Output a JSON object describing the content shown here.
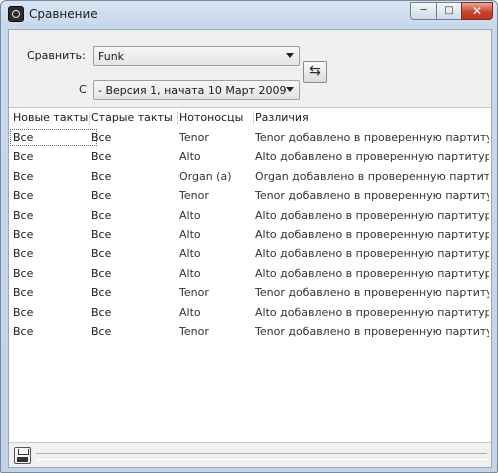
{
  "window": {
    "title": "Сравнение",
    "icon": "app-icon"
  },
  "compare": {
    "label": "Сравнить:",
    "value": "Funk",
    "with_label": "С",
    "with_value": "- Версия 1, начата 10 Март 2009",
    "swap_icon": "swap-arrows-icon"
  },
  "table": {
    "headers": [
      "Новые такты",
      "Старые такты",
      "Нотоносцы",
      "Различия"
    ],
    "rows": [
      [
        "Все",
        "Все",
        "Tenor",
        "Tenor добавлено в проверенную партиту..."
      ],
      [
        "Все",
        "Все",
        "Alto",
        "Alto добавлено в проверенную партитуру"
      ],
      [
        "Все",
        "Все",
        "Organ (a)",
        "Organ добавлено в проверенную партит..."
      ],
      [
        "Все",
        "Все",
        "Tenor",
        "Tenor добавлено в проверенную партиту..."
      ],
      [
        "Все",
        "Все",
        "Alto",
        "Alto добавлено в проверенную партитуру"
      ],
      [
        "Все",
        "Все",
        "Alto",
        "Alto добавлено в проверенную партитуру"
      ],
      [
        "Все",
        "Все",
        "Alto",
        "Alto добавлено в проверенную партитуру"
      ],
      [
        "Все",
        "Все",
        "Alto",
        "Alto добавлено в проверенную партитуру"
      ],
      [
        "Все",
        "Все",
        "Tenor",
        "Tenor добавлено в проверенную партиту..."
      ],
      [
        "Все",
        "Все",
        "Alto",
        "Alto добавлено в проверенную партитуру"
      ],
      [
        "Все",
        "Все",
        "Tenor",
        "Tenor добавлено в проверенную партиту..."
      ]
    ]
  },
  "statusbar": {
    "save_icon": "save-icon"
  }
}
